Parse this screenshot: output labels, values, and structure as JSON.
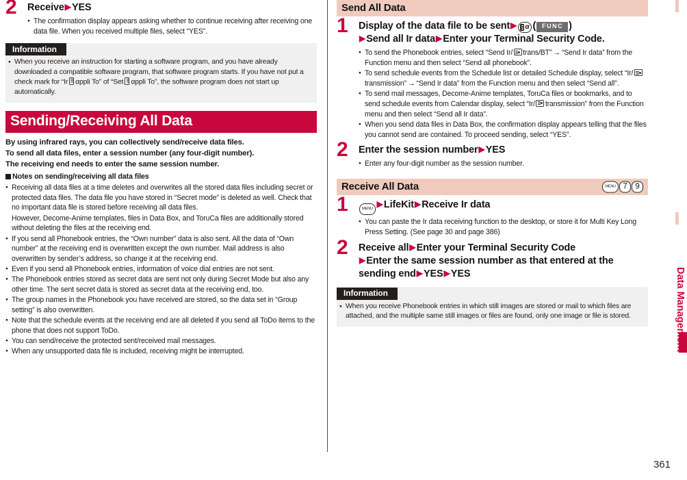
{
  "page": {
    "number": "361",
    "side_tab_label": "Data Management"
  },
  "left_column": {
    "step2": {
      "num": "2",
      "head_part1": "Receive",
      "head_arrow": "▶",
      "head_part2": "YES",
      "bullets": [
        "The confirmation display appears asking whether to continue receiving after receiving one data file. When you received multiple files, select “YES”."
      ]
    },
    "information": {
      "tag": "Information",
      "bullet_pre": "When you receive an instruction for starting a software program, and you have already downloaded a compatible software program, that software program starts. If you have not put a check mark for “Ir",
      "bullet_mid": "αppli To” of “Set",
      "bullet_post": "αppli To”, the software program does not start up automatically."
    },
    "banner": "Sending/Receiving All Data",
    "intro": [
      "By using infrared rays, you can collectively send/receive data files.",
      "To send all data files, enter a session number (any four-digit number).",
      "The receiving end needs to enter the same session number."
    ],
    "subhead": "Notes on sending/receiving all data files",
    "notes": [
      {
        "bullet": true,
        "text": "Receiving all data files at a time deletes and overwrites all the stored data files including secret or protected data files. The data file you have stored in “Secret mode” is deleted as well. Check that no important data file is stored before receiving all data files."
      },
      {
        "bullet": false,
        "text": "However, Decome-Anime templates, files in Data Box, and ToruCa files are additionally stored without deleting the files at the receiving end."
      },
      {
        "bullet": true,
        "text": "If you send all Phonebook entries, the “Own number” data is also sent. All the data of “Own number” at the receiving end is overwritten except the own number. Mail address is also overwritten by sender’s address, so change it at the receiving end."
      },
      {
        "bullet": true,
        "text": "Even if you send all Phonebook entries, information of voice dial entries are not sent."
      },
      {
        "bullet": true,
        "text": "The Phonebook entries stored as secret data are sent not only during Secret Mode but also any other time. The sent secret data is stored as secret data at the receiving end, too."
      },
      {
        "bullet": true,
        "text": "The group names in the Phonebook you have received are stored, so the data set in “Group setting” is also overwritten."
      },
      {
        "bullet": true,
        "text": "Note that the schedule events at the receiving end are all deleted if you send all ToDo items to the phone that does not support ToDo."
      },
      {
        "bullet": true,
        "text": "You can send/receive the protected sent/received mail messages."
      },
      {
        "bullet": true,
        "text": "When any unsupported data file is included, receiving might be interrupted."
      }
    ]
  },
  "right_column": {
    "send_section": {
      "title": "Send All Data",
      "step1": {
        "num": "1",
        "line1_pre": "Display of the data file to be sent",
        "arrow": "▶",
        "func_label": "FUNC",
        "paren_open": "(",
        "paren_close": ")",
        "line2_a": "Send all Ir data",
        "line2_b": "Enter your Terminal Security Code.",
        "bullets": [
          {
            "pre": "To send the Phonebook entries, select “Send Ir/",
            "icon": "ic-chip-icon",
            "mid": "trans/BT”",
            "arrow": "→",
            "post": "“Send Ir data” from the Function menu and then select “Send all phonebook”."
          },
          {
            "pre": "To send schedule events from the Schedule list or detailed Schedule display, select “Ir/",
            "icon": "ic-chip-icon",
            "mid": "transmission”",
            "arrow": "→",
            "post": "“Send Ir data” from the Function menu and then select “Send all”."
          },
          {
            "pre": "To send mail messages, Decome-Anime templates, ToruCa files or bookmarks, and to send schedule events from Calendar display, select “Ir/",
            "icon": "ic-chip-icon",
            "mid": "transmission” from the Function menu and then select “Send all Ir data”.",
            "arrow": "",
            "post": ""
          },
          {
            "pre": "When you send data files in Data Box, the confirmation display appears telling that the files you cannot send are contained. To proceed sending, select “YES”.",
            "icon": "",
            "mid": "",
            "arrow": "",
            "post": ""
          }
        ]
      },
      "step2": {
        "num": "2",
        "head_part1": "Enter the session number",
        "head_arrow": "▶",
        "head_part2": "YES",
        "bullets": [
          "Enter any four-digit number as the session number."
        ]
      }
    },
    "receive_section": {
      "title": "Receive All Data",
      "keys": [
        "MENU",
        "7",
        "9"
      ],
      "step1": {
        "num": "1",
        "key_label": "MENU",
        "arrow": "▶",
        "part_a": "LifeKit",
        "part_b": "Receive Ir data",
        "bullets": [
          "You can paste the Ir data receiving function to the desktop, or store it for Multi Key Long Press Setting. (See page 30 and page 386)"
        ]
      },
      "step2": {
        "num": "2",
        "line1_a": "Receive all",
        "line1_b": "Enter your Terminal Security Code",
        "line2": "Enter the same session number as that entered at the",
        "line3_a": "sending end",
        "line3_b": "YES",
        "line3_c": "YES",
        "arrow": "▶"
      },
      "information": {
        "tag": "Information",
        "bullets": [
          "When you receive Phonebook entries in which still images are stored or mail to which files are attached, and the multiple same still images or files are found, only one image or file is stored."
        ]
      }
    }
  },
  "colors": {
    "accent_red": "#c8083c",
    "section_pink": "#f0cbbd",
    "info_bg": "#f0f0f0",
    "info_tag_bg": "#231f1c",
    "func_gray": "#6e6e6e"
  }
}
